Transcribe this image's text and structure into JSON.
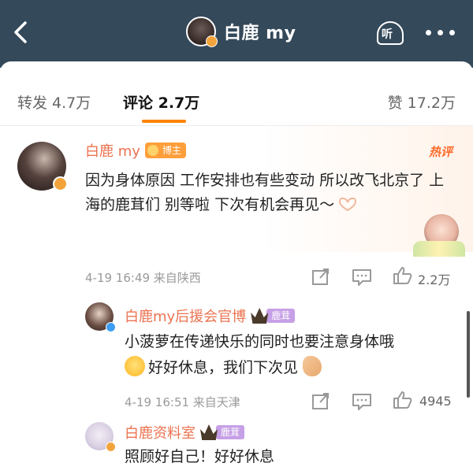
{
  "header": {
    "title": "白鹿 my",
    "listen_label": "听"
  },
  "tabs": {
    "repost": "转发 4.7万",
    "comment": "评论 2.7万",
    "like": "赞 17.2万"
  },
  "comments": [
    {
      "author": "白鹿 my",
      "badge": "博主",
      "hot_label": "热评",
      "text": "因为身体原因 工作安排也有些变动 所以改飞北京了 上海的鹿茸们 别等啦 下次有机会再见～",
      "time": "4-19 16:49 来自陕西",
      "likes": "2.2万"
    },
    {
      "author": "白鹿my后援会官博",
      "badge": "鹿茸",
      "text_line1": "小菠萝在传递快乐的同时也要注意身体哦",
      "text_line2": "好好休息，我们下次见",
      "time": "4-19 16:51 来自天津",
      "likes": "4945"
    },
    {
      "author": "白鹿资料室",
      "badge": "鹿茸",
      "text": "照顾好自己！好好休息"
    }
  ],
  "colors": {
    "header_bg": "#34495a",
    "accent": "#ff8200",
    "author": "#eb7350"
  }
}
